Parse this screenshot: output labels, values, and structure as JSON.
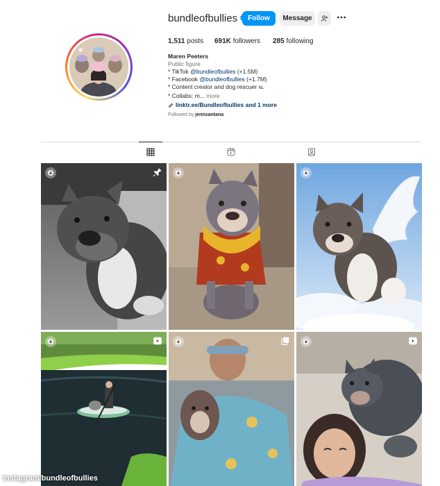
{
  "profile": {
    "username": "bundleofbullies",
    "follow_label": "Follow",
    "message_label": "Message"
  },
  "stats": {
    "posts_count": "1,511",
    "posts_label": "posts",
    "followers_count": "691K",
    "followers_label": "followers",
    "following_count": "285",
    "following_label": "following"
  },
  "bio": {
    "name": "Maren Peeters",
    "category": "Public figure",
    "line1_prefix": "* TikTok ",
    "line1_mention": "@bundleofbullies",
    "line1_suffix": " (+1.5M)",
    "line2_prefix": "* Facebook ",
    "line2_mention": "@bundleofbullies",
    "line2_suffix": " (+1.7M)",
    "line3": "* Content creator and dog rescuer",
    "line3_flag": "NL",
    "line4_prefix": "* Collabs: m...",
    "line4_more": " more",
    "link": "linktr.ee/Bundleofbullies and 1 more"
  },
  "followed_by": {
    "prefix": "Followed by ",
    "user": "jennsantana"
  },
  "tabs": [
    {
      "icon": "grid-icon",
      "active": true
    },
    {
      "icon": "reels-icon",
      "active": false
    },
    {
      "icon": "tagged-icon",
      "active": false
    }
  ],
  "caption": "Instagram/bundleofbullies",
  "colors": {
    "accent": "#0095f6",
    "text": "#262626",
    "muted": "#737373",
    "link": "#00376b"
  }
}
